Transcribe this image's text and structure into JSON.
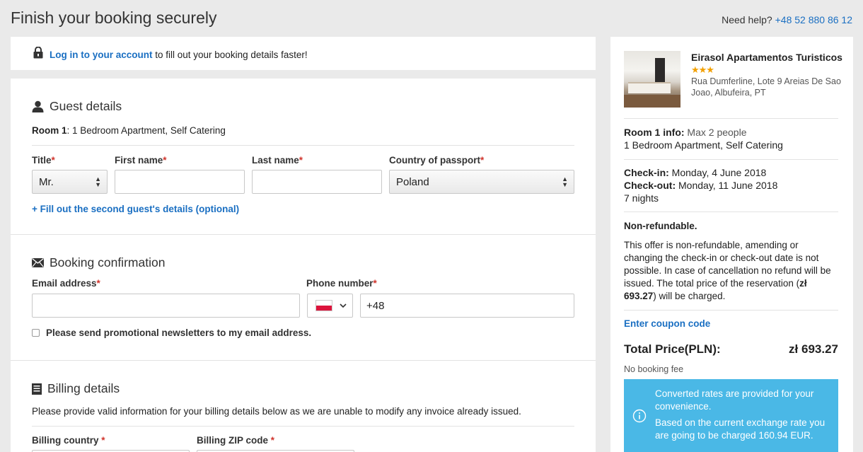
{
  "header": {
    "title": "Finish your booking securely",
    "help_label": "Need help?",
    "help_phone": "+48 52 880 86 12"
  },
  "login": {
    "link": "Log in to your account",
    "text": " to fill out your booking details faster!"
  },
  "guest": {
    "title": "Guest details",
    "room_prefix": "Room 1",
    "room_desc": ": 1 Bedroom Apartment, Self Catering",
    "title_label": "Title",
    "title_value": "Mr.",
    "first_name_label": "First name",
    "first_name_value": "",
    "last_name_label": "Last name",
    "last_name_value": "",
    "country_label": "Country of passport",
    "country_value": "Poland",
    "second_guest_link": "+ Fill out the second guest's details (optional)",
    "required_mark": "*"
  },
  "confirmation": {
    "title": "Booking confirmation",
    "email_label": "Email address",
    "email_value": "",
    "phone_label": "Phone number",
    "phone_value": "+48",
    "newsletter_label": "Please send promotional newsletters to my email address."
  },
  "billing": {
    "title": "Billing details",
    "note": "Please provide valid information for your billing details below as we are unable to modify any invoice already issued.",
    "country_label": "Billing country ",
    "zip_label": "Billing ZIP code "
  },
  "sidebar": {
    "hotel_name": "Eirasol Apartamentos Turisticos",
    "stars": "★★★",
    "address": "Rua Dumferline, Lote 9 Areias De Sao Joao, Albufeira, PT",
    "room_info_label": "Room 1 info:",
    "room_info_value": " Max 2 people",
    "room_type": "1 Bedroom Apartment, Self Catering",
    "checkin_label": "Check-in:",
    "checkin_value": " Monday, 4 June 2018",
    "checkout_label": "Check-out:",
    "checkout_value": " Monday, 11 June 2018",
    "nights": "7 nights",
    "nonref_title": "Non-refundable.",
    "nonref_body_1": "This offer is non-refundable, amending or changing the check-in or check-out date is not possible. In case of cancellation no refund will be issued. The total price of the reservation (",
    "nonref_amount": "zł 693.27",
    "nonref_body_2": ") will be charged.",
    "coupon_link": "Enter coupon code",
    "total_label": "Total Price(PLN):",
    "total_value": "zł 693.27",
    "fee_note": "No booking fee",
    "info_1": "Converted rates are provided for your convenience.",
    "info_2": "Based on the current exchange rate you are going to be charged 160.94 EUR."
  },
  "colors": {
    "accent": "#1a6fc2",
    "required": "#d0342c",
    "info_box": "#4ab8e6",
    "stars": "#f2a000"
  }
}
